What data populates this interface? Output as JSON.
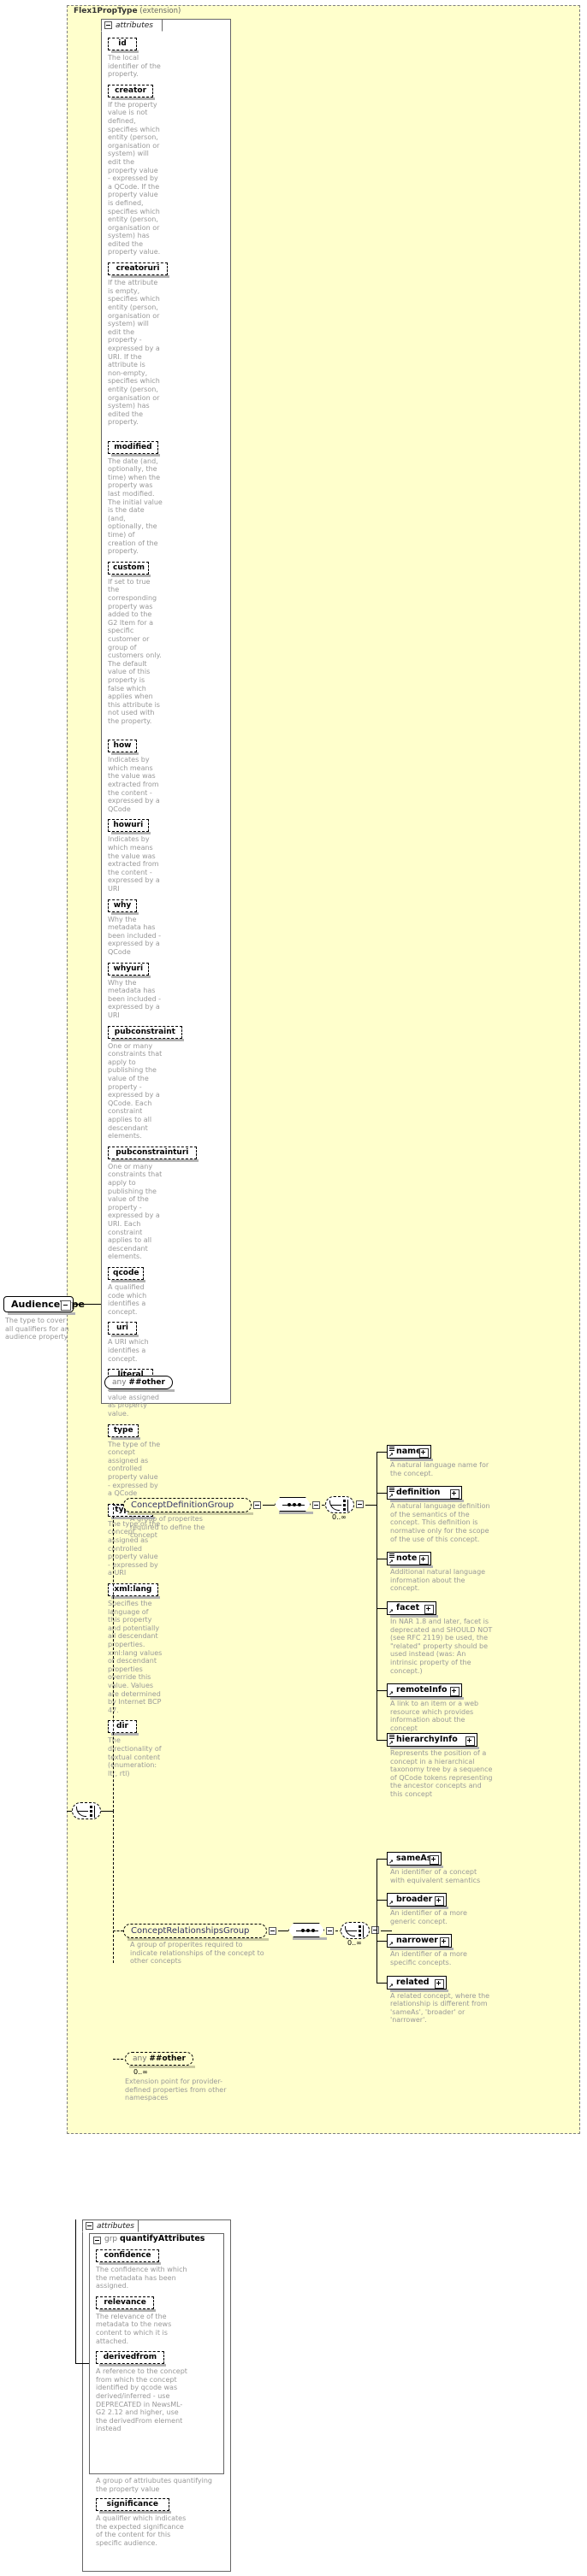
{
  "diagram": {
    "type": "xml-schema-diagram",
    "colors": {
      "panel_bg": "#ffffcc",
      "panel_border": "#808080",
      "desc_text": "#999999",
      "group_text": "#336699",
      "box_bg": "#ffffff",
      "shadow": "#b3b3b3"
    }
  },
  "root_type": {
    "name": "Flex1PropType",
    "derivation": "(extension)"
  },
  "left_type": {
    "name": "AudienceType",
    "description": "The type to cover all qualifiers for an audience property"
  },
  "attributes_section": {
    "tab_label": "attributes",
    "items": [
      {
        "name": "id",
        "description": "The local identifier of the property."
      },
      {
        "name": "creator",
        "description": "If the property value is not defined, specifies which entity (person, organisation or system) will edit the property value - expressed by a QCode. If the property value is defined, specifies which entity (person, organisation or system) has edited the property value."
      },
      {
        "name": "creatoruri",
        "description": "If the attribute is empty, specifies which entity (person, organisation or system) will edit the property - expressed by a URI. If the attribute is non-empty, specifies which entity (person, organisation or system) has edited the property."
      },
      {
        "name": "modified",
        "description": "The date (and, optionally, the time) when the property was last modified. The initial value is the date (and, optionally, the time) of creation of the property."
      },
      {
        "name": "custom",
        "description": "If set to true the corresponding property was added to the G2 Item for a specific customer or group of customers only. The default value of this property is false which applies when this attribute is not used with the property."
      },
      {
        "name": "how",
        "description": "Indicates by which means the value was extracted from the content - expressed by a QCode"
      },
      {
        "name": "howuri",
        "description": "Indicates by which means the value was extracted from the content - expressed by a URI"
      },
      {
        "name": "why",
        "description": "Why the metadata has been included - expressed by a QCode"
      },
      {
        "name": "whyuri",
        "description": "Why the metadata has been included - expressed by a URI"
      },
      {
        "name": "pubconstraint",
        "description": "One or many constraints that apply to publishing the value of the property - expressed by a QCode. Each constraint applies to all descendant elements."
      },
      {
        "name": "pubconstrainturi",
        "description": "One or many constraints that apply to publishing the value of the property - expressed by a URI. Each constraint applies to all descendant elements."
      },
      {
        "name": "qcode",
        "description": "A qualified code which identifies a concept."
      },
      {
        "name": "uri",
        "description": "A URI which identifies a concept."
      },
      {
        "name": "literal",
        "description": "A free-text value assigned as property value."
      },
      {
        "name": "type",
        "description": "The type of the concept assigned as controlled property value - expressed by a QCode"
      },
      {
        "name": "typeuri",
        "description": "The type of the concept assigned as controlled property value - expressed by a URI"
      },
      {
        "name": "xml:lang",
        "description": "Specifies the language of this property and potentially all descendant properties. xml:lang values of descendant properties override this value. Values are determined by Internet BCP 47."
      },
      {
        "name": "dir",
        "description": "The directionality of textual content (enumeration: ltr, rtl)"
      }
    ],
    "any_label_prefix": "any",
    "any_label_bold": "##other"
  },
  "content_model": {
    "occurs_main": "0..∞",
    "groups": [
      {
        "name": "ConceptDefinitionGroup",
        "description": "A group of properites required to define the concept",
        "occurs": "0..∞",
        "elements": [
          {
            "name": "name",
            "description": "A natural language name for the concept.",
            "has_sequence_mark": true
          },
          {
            "name": "definition",
            "description": "A natural language definition of the semantics of the concept. This definition is normative only for the scope of the use of this concept.",
            "has_sequence_mark": true
          },
          {
            "name": "note",
            "description": "Additional natural language information about the concept.",
            "has_sequence_mark": true
          },
          {
            "name": "facet",
            "description": "In NAR 1.8 and later, facet is deprecated and SHOULD NOT (see RFC 2119) be used, the \"related\" property should be used instead (was: An intrinsic property of the concept.)",
            "has_sequence_mark": false
          },
          {
            "name": "remoteInfo",
            "description": "A link to an item or a web resource which provides information about the concept",
            "has_sequence_mark": false
          },
          {
            "name": "hierarchyInfo",
            "description": "Represents the position of a concept in a hierarchical taxonomy tree by a sequence of QCode tokens representing the ancestor concepts and this concept",
            "has_sequence_mark": true
          }
        ]
      },
      {
        "name": "ConceptRelationshipsGroup",
        "description": "A group of properites required to indicate relationships of the concept to other concepts",
        "occurs": "0..∞",
        "elements": [
          {
            "name": "sameAs",
            "description": "An identifier of a concept with equivalent semantics",
            "has_sequence_mark": false
          },
          {
            "name": "broader",
            "description": "An identifier of a more generic concept.",
            "has_sequence_mark": false
          },
          {
            "name": "narrower",
            "description": "An identifier of a more specific concepts.",
            "has_sequence_mark": false
          },
          {
            "name": "related",
            "description": "A related concept, where the relationship is different from 'sameAs', 'broader' or 'narrower'.",
            "has_sequence_mark": false
          }
        ]
      }
    ],
    "any_other": {
      "label_prefix": "any",
      "label_bold": "##other",
      "occurs": "0..∞",
      "description": "Extension point for provider-defined properties from other namespaces"
    }
  },
  "bottom_attributes_section": {
    "tab_label": "attributes",
    "group_prefix": "grp",
    "group_name": "quantifyAttributes",
    "group_description": "A group of attriubutes quantifying the property value",
    "items": [
      {
        "name": "confidence",
        "description": "The confidence with which the metadata has been assigned."
      },
      {
        "name": "relevance",
        "description": "The relevance of the metadata to the news content to which it is attached."
      },
      {
        "name": "derivedfrom",
        "description": "A reference to the concept from which the concept identified by qcode was derived/inferred - use DEPRECATED in NewsML-G2 2.12 and higher, use the derivedFrom element instead"
      }
    ],
    "trailing_items": [
      {
        "name": "significance",
        "description": "A qualifier which indicates the expected significance of the content for this specific audience."
      }
    ]
  }
}
